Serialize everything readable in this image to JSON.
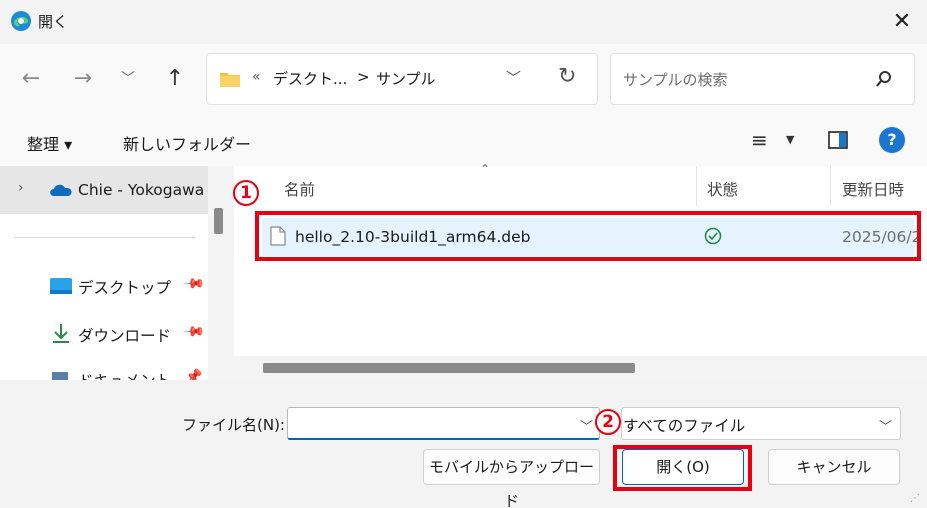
{
  "window": {
    "title": "開く"
  },
  "nav": {
    "breadcrumb_sep": "«",
    "breadcrumb_1": "デスクト...",
    "breadcrumb_arrow": ">",
    "breadcrumb_2": "サンプル"
  },
  "search": {
    "placeholder": "サンプルの検索"
  },
  "commandbar": {
    "organize": "整理 ▾",
    "new_folder": "新しいフォルダー"
  },
  "sidebar": {
    "items": [
      {
        "label": "Chie - Yokogawa"
      },
      {
        "label": "デスクトップ"
      },
      {
        "label": "ダウンロード"
      },
      {
        "label": "ドキュメント"
      }
    ]
  },
  "columns": {
    "name": "名前",
    "status": "状態",
    "modified": "更新日時"
  },
  "files": [
    {
      "name": "hello_2.10-3build1_arm64.deb",
      "modified": "2025/06/2"
    }
  ],
  "annotations": {
    "one": "1",
    "two": "2"
  },
  "footer": {
    "filename_label": "ファイル名(N):",
    "filename_value": "",
    "filter_value": "すべてのファイル",
    "upload_button": "モバイルからアップロード",
    "open_button": "開く(O)",
    "cancel_button": "キャンセル"
  },
  "colors": {
    "accent": "#0067c0",
    "annotation_red": "#e60012",
    "selected_row": "#e5f3ff"
  }
}
